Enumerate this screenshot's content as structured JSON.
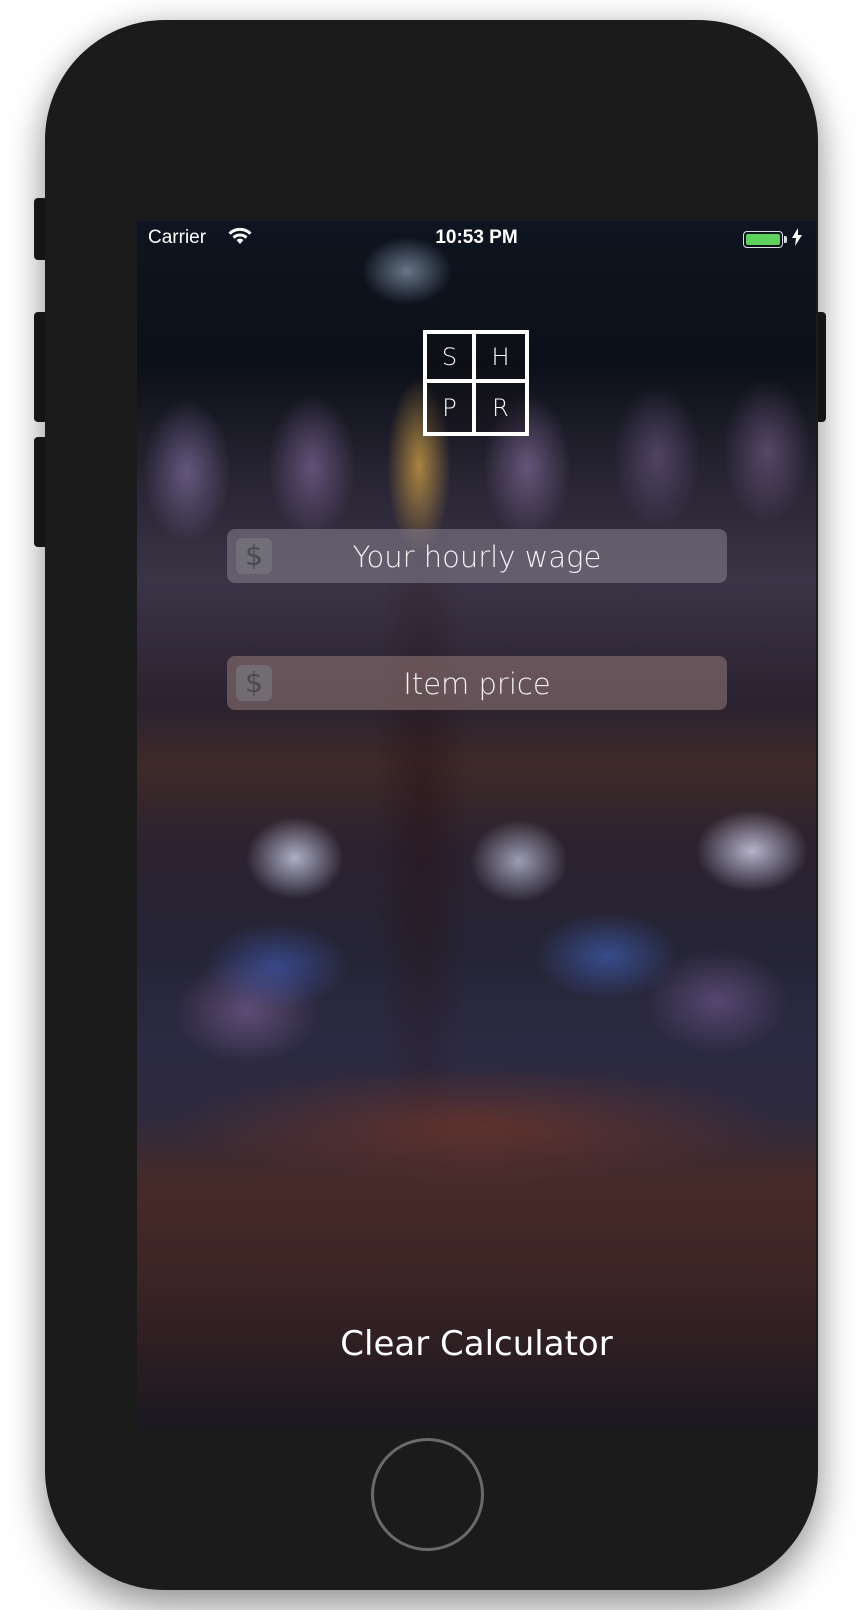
{
  "status_bar": {
    "carrier": "Carrier",
    "time": "10:53 PM",
    "battery_color": "#5cd25c"
  },
  "logo": {
    "letters": [
      "S",
      "H",
      "P",
      "R"
    ]
  },
  "fields": {
    "hourly_wage": {
      "icon": "dollar-icon",
      "symbol": "$",
      "placeholder": "Your hourly wage",
      "value": ""
    },
    "item_price": {
      "icon": "dollar-icon",
      "symbol": "$",
      "placeholder": "Item price",
      "value": ""
    }
  },
  "actions": {
    "clear_label": "Clear Calculator"
  }
}
